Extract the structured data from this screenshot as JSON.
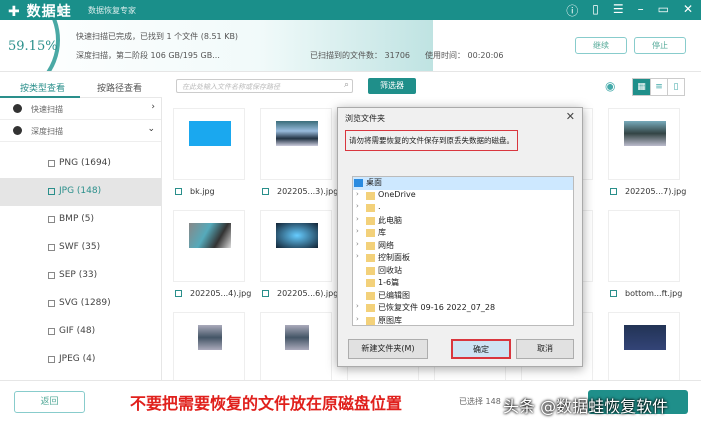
{
  "titlebar": {
    "logo": "数据蛙",
    "slogan": "数据恢复专家",
    "icons": [
      "help-icon",
      "save-icon",
      "menu-icon",
      "minimize-icon",
      "maximize-icon",
      "close-icon"
    ]
  },
  "status": {
    "percent": "59.15%",
    "progress": 59.15,
    "line1": "快速扫描已完成，已找到 1 个文件 (8.51 KB)",
    "line2": "深度扫描，第二阶段 106 GB/195 GB...",
    "files_label": "已扫描到的文件数：",
    "files_count": "31706",
    "time_label": "使用时间：",
    "time": "00:20:06",
    "continue": "继续",
    "stop": "停止"
  },
  "tabs": {
    "by_type": "按类型查看",
    "by_path": "按路径查看"
  },
  "sidebar": {
    "quick_scan": "快速扫描",
    "deep_scan": "深度扫描",
    "types": [
      {
        "label": "PNG (1694)",
        "checked": false
      },
      {
        "label": "JPG (148)",
        "checked": true
      },
      {
        "label": "BMP (5)",
        "checked": false
      },
      {
        "label": "SWF (35)",
        "checked": false
      },
      {
        "label": "SEP (33)",
        "checked": false
      },
      {
        "label": "SVG (1289)",
        "checked": false
      },
      {
        "label": "GIF (48)",
        "checked": false
      },
      {
        "label": "JPEG (4)",
        "checked": false
      }
    ]
  },
  "toolbar": {
    "search_placeholder": "在此处输入文件名称或保存路径",
    "filter": "筛选器"
  },
  "files": [
    "bk.jpg",
    "202205...3).jpg",
    "202205...7).jpg",
    "202205...4).jpg",
    "202205...6).jpg",
    "bottom...ft.jpg"
  ],
  "dialog": {
    "title": "浏览文件夹",
    "message": "请勿将需要恢复的文件保存到原丢失数据的磁盘。",
    "tree": [
      "桌面",
      "OneDrive",
      ".",
      "此电脑",
      "库",
      "网络",
      "控制面板",
      "回收站",
      "1-6篇",
      "已编辑图",
      "已恢复文件 09-16 2022_07_28",
      "原图库"
    ],
    "new_folder": "新建文件夹(M)",
    "ok": "确定",
    "cancel": "取消"
  },
  "bottom": {
    "back": "返回",
    "warning": "不要把需要恢复的文件放在原磁盘位置",
    "selected": "已选择 148",
    "watermark": "头条 @数据蛙恢复软件"
  }
}
